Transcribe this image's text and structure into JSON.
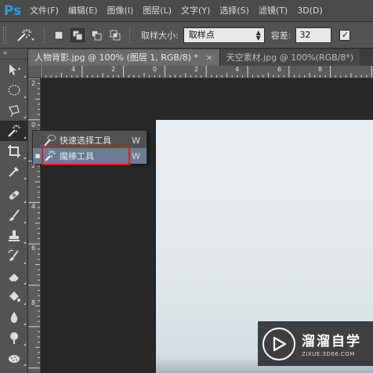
{
  "app": {
    "logo": "Ps"
  },
  "menu": [
    "文件(F)",
    "编辑(E)",
    "图像(I)",
    "图层(L)",
    "文字(Y)",
    "选择(S)",
    "滤镜(T)",
    "3D(D)"
  ],
  "options": {
    "sample_size_label": "取样大小:",
    "sample_size_value": "取样点",
    "tolerance_label": "容差:",
    "tolerance_value": "32",
    "checkbox_checked": "✓"
  },
  "tabs": [
    {
      "label": "人物背影.jpg @ 100% (图层 1, RGB/8) *",
      "close": "×"
    },
    {
      "label": "天空素材.jpg @ 100%(RGB/8*)",
      "close": ""
    }
  ],
  "toolbar": {
    "collapse": "»"
  },
  "rulers": {
    "h": [
      "4",
      "2",
      "0",
      "2",
      "4",
      "6",
      "8"
    ],
    "v": [
      "2",
      "0",
      "2",
      "4",
      "6",
      "8"
    ]
  },
  "flyout": {
    "items": [
      {
        "label": "快速选择工具",
        "key": "W",
        "selected": false,
        "bullet": ""
      },
      {
        "label": "魔棒工具",
        "key": "W",
        "selected": true,
        "bullet": "■"
      }
    ]
  },
  "watermark": {
    "title": "溜溜自学",
    "sub": "ZIXUE.3D66.COM"
  },
  "colors": {
    "accent": "#2d9cdb",
    "highlight": "#d11f1f",
    "selection": "#6c7c95"
  }
}
